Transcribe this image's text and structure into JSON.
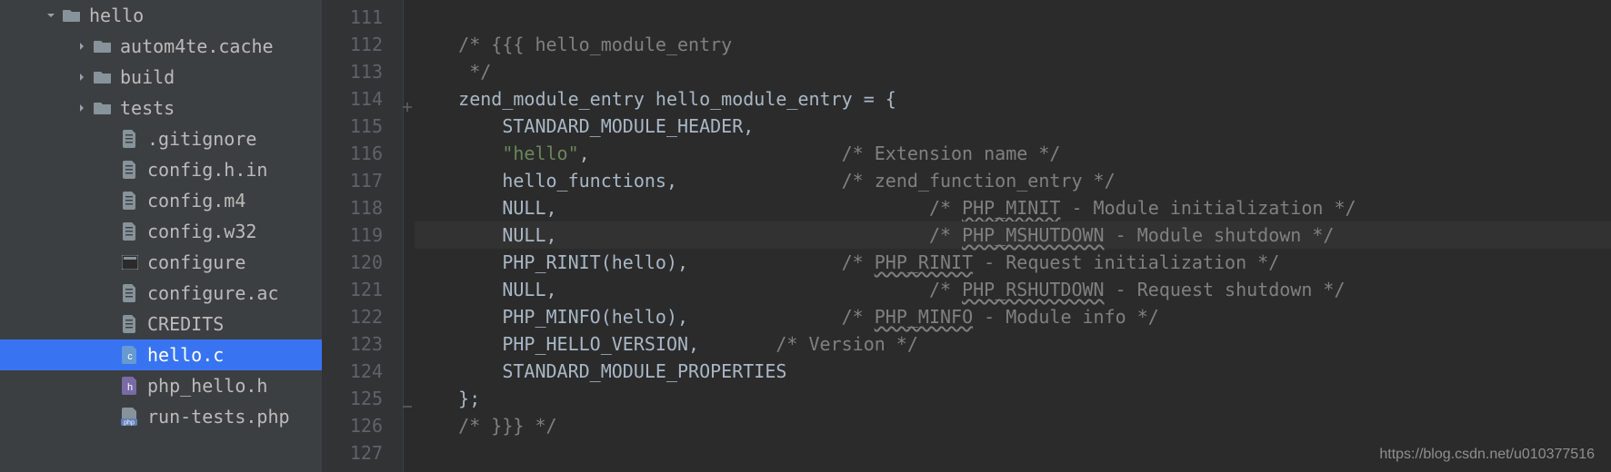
{
  "sidebar": {
    "items": [
      {
        "label": "hello",
        "indent": 48,
        "arrow": "down",
        "icon": "folder"
      },
      {
        "label": "autom4te.cache",
        "indent": 82,
        "arrow": "right",
        "icon": "folder"
      },
      {
        "label": "build",
        "indent": 82,
        "arrow": "right",
        "icon": "folder"
      },
      {
        "label": "tests",
        "indent": 82,
        "arrow": "right",
        "icon": "folder"
      },
      {
        "label": ".gitignore",
        "indent": 112,
        "arrow": "none",
        "icon": "file"
      },
      {
        "label": "config.h.in",
        "indent": 112,
        "arrow": "none",
        "icon": "file"
      },
      {
        "label": "config.m4",
        "indent": 112,
        "arrow": "none",
        "icon": "file"
      },
      {
        "label": "config.w32",
        "indent": 112,
        "arrow": "none",
        "icon": "file"
      },
      {
        "label": "configure",
        "indent": 112,
        "arrow": "none",
        "icon": "exec"
      },
      {
        "label": "configure.ac",
        "indent": 112,
        "arrow": "none",
        "icon": "file"
      },
      {
        "label": "CREDITS",
        "indent": 112,
        "arrow": "none",
        "icon": "file"
      },
      {
        "label": "hello.c",
        "indent": 112,
        "arrow": "none",
        "icon": "cfile",
        "selected": true
      },
      {
        "label": "php_hello.h",
        "indent": 112,
        "arrow": "none",
        "icon": "hfile"
      },
      {
        "label": "run-tests.php",
        "indent": 112,
        "arrow": "none",
        "icon": "phpfile"
      }
    ]
  },
  "editor": {
    "first_line_number": 111,
    "current_line_number": 119,
    "lines": [
      {
        "tokens": []
      },
      {
        "tokens": [
          {
            "t": "    ",
            "c": ""
          },
          {
            "t": "/* {{{ hello_module_entry",
            "c": "c-comment"
          }
        ]
      },
      {
        "tokens": [
          {
            "t": "     ",
            "c": ""
          },
          {
            "t": "*/",
            "c": "c-comment"
          }
        ]
      },
      {
        "fold": "open",
        "tokens": [
          {
            "t": "    ",
            "c": ""
          },
          {
            "t": "zend_module_entry hello_module_entry = {",
            "c": "c-ident"
          }
        ]
      },
      {
        "tokens": [
          {
            "t": "        ",
            "c": ""
          },
          {
            "t": "STANDARD_MODULE_HEADER,",
            "c": "c-ident"
          }
        ]
      },
      {
        "tokens": [
          {
            "t": "        ",
            "c": ""
          },
          {
            "t": "\"hello\"",
            "c": "c-string"
          },
          {
            "t": ",                       ",
            "c": "c-ident"
          },
          {
            "t": "/* Extension name */",
            "c": "c-comment"
          }
        ]
      },
      {
        "tokens": [
          {
            "t": "        ",
            "c": ""
          },
          {
            "t": "hello_functions,               ",
            "c": "c-ident"
          },
          {
            "t": "/* zend_function_entry */",
            "c": "c-comment"
          }
        ]
      },
      {
        "tokens": [
          {
            "t": "        ",
            "c": ""
          },
          {
            "t": "NULL,                                  ",
            "c": "c-ident"
          },
          {
            "t": "/* ",
            "c": "c-comment"
          },
          {
            "t": "PHP_MINIT",
            "c": "c-comment c-underline"
          },
          {
            "t": " - Module initialization */",
            "c": "c-comment"
          }
        ]
      },
      {
        "tokens": [
          {
            "t": "        ",
            "c": ""
          },
          {
            "t": "NULL,                                  ",
            "c": "c-ident"
          },
          {
            "t": "/* ",
            "c": "c-comment"
          },
          {
            "t": "PHP_MSHUTDOWN",
            "c": "c-comment c-underline"
          },
          {
            "t": " - Module shutdown */",
            "c": "c-comment"
          }
        ]
      },
      {
        "tokens": [
          {
            "t": "        ",
            "c": ""
          },
          {
            "t": "PHP_RINIT(hello),              ",
            "c": "c-ident"
          },
          {
            "t": "/* ",
            "c": "c-comment"
          },
          {
            "t": "PHP_RINIT",
            "c": "c-comment c-underline"
          },
          {
            "t": " - Request initialization */",
            "c": "c-comment"
          }
        ]
      },
      {
        "tokens": [
          {
            "t": "        ",
            "c": ""
          },
          {
            "t": "NULL,                                  ",
            "c": "c-ident"
          },
          {
            "t": "/* ",
            "c": "c-comment"
          },
          {
            "t": "PHP_RSHUTDOWN",
            "c": "c-comment c-underline"
          },
          {
            "t": " - Request shutdown */",
            "c": "c-comment"
          }
        ]
      },
      {
        "tokens": [
          {
            "t": "        ",
            "c": ""
          },
          {
            "t": "PHP_MINFO(hello),              ",
            "c": "c-ident"
          },
          {
            "t": "/* ",
            "c": "c-comment"
          },
          {
            "t": "PHP_MINFO",
            "c": "c-comment c-underline"
          },
          {
            "t": " - Module info */",
            "c": "c-comment"
          }
        ]
      },
      {
        "tokens": [
          {
            "t": "        ",
            "c": ""
          },
          {
            "t": "PHP_HELLO_VERSION,       ",
            "c": "c-ident"
          },
          {
            "t": "/* Version */",
            "c": "c-comment"
          }
        ]
      },
      {
        "tokens": [
          {
            "t": "        ",
            "c": ""
          },
          {
            "t": "STANDARD_MODULE_PROPERTIES",
            "c": "c-ident"
          }
        ]
      },
      {
        "fold": "close",
        "tokens": [
          {
            "t": "    ",
            "c": ""
          },
          {
            "t": "};",
            "c": "c-ident"
          }
        ]
      },
      {
        "tokens": [
          {
            "t": "    ",
            "c": ""
          },
          {
            "t": "/* }}} */",
            "c": "c-comment"
          }
        ]
      },
      {
        "tokens": []
      }
    ]
  },
  "watermark": "https://blog.csdn.net/u010377516"
}
